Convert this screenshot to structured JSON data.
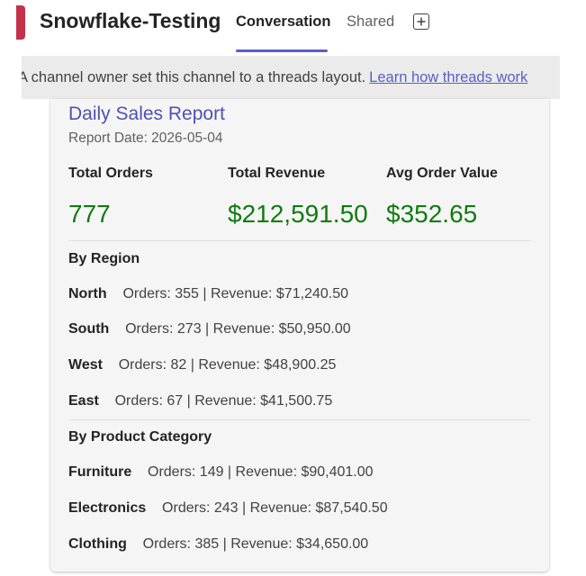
{
  "header": {
    "title": "Snowflake-Testing",
    "tabs": [
      {
        "label": "Conversation",
        "active": true
      },
      {
        "label": "Shared",
        "active": false
      }
    ],
    "add_tab_icon": "plus-icon",
    "accent_color": "#c4314b",
    "tab_underline_color": "#5b5fc7"
  },
  "banner": {
    "text": "A channel owner set this channel to a threads layout.",
    "link": "Learn how threads work"
  },
  "report": {
    "title": "Daily Sales Report",
    "date": "Report Date: 2026-05-04",
    "kpis": [
      {
        "label": "Total Orders",
        "value": "777"
      },
      {
        "label": "Total Revenue",
        "value": "$212,591.50"
      },
      {
        "label": "Avg Order Value",
        "value": "$352.65"
      }
    ],
    "kpi_color": "#107c10",
    "by_region": {
      "title": "By Region",
      "rows": [
        {
          "name": "North",
          "detail": "Orders: 355 | Revenue: $71,240.50"
        },
        {
          "name": "South",
          "detail": "Orders: 273 | Revenue: $50,950.00"
        },
        {
          "name": "West",
          "detail": "Orders: 82 | Revenue: $48,900.25"
        },
        {
          "name": "East",
          "detail": "Orders: 67 | Revenue: $41,500.75"
        }
      ]
    },
    "by_category": {
      "title": "By Product Category",
      "rows": [
        {
          "name": "Furniture",
          "detail": "Orders: 149 | Revenue: $90,401.00"
        },
        {
          "name": "Electronics",
          "detail": "Orders: 243 | Revenue: $87,540.50"
        },
        {
          "name": "Clothing",
          "detail": "Orders: 385 | Revenue: $34,650.00"
        }
      ]
    }
  }
}
